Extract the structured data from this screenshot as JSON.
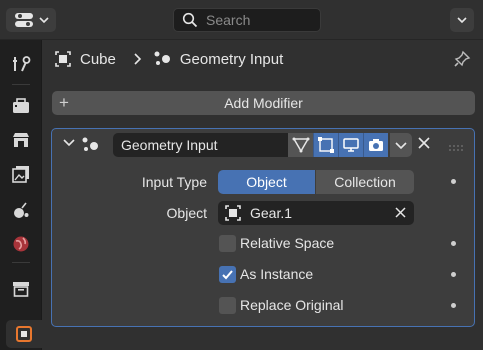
{
  "header": {
    "search_placeholder": "Search"
  },
  "tabs": [
    {
      "name": "tool",
      "icon": "tool-icon"
    },
    {
      "name": "render",
      "icon": "render-icon"
    },
    {
      "name": "output",
      "icon": "output-icon"
    },
    {
      "name": "view-layer",
      "icon": "view-layer-icon"
    },
    {
      "name": "scene",
      "icon": "scene-icon"
    },
    {
      "name": "world",
      "icon": "world-icon"
    },
    {
      "name": "collection",
      "icon": "collection-icon"
    },
    {
      "name": "object",
      "icon": "object-icon",
      "active": true
    }
  ],
  "breadcrumb": {
    "object": "Cube",
    "modifier": "Geometry Input"
  },
  "add_modifier_label": "Add Modifier",
  "modifier": {
    "name": "Geometry Input",
    "input_type_label": "Input Type",
    "input_type_options": [
      "Object",
      "Collection"
    ],
    "input_type_selected": "Object",
    "object_label": "Object",
    "object_value": "Gear.1",
    "relative_space_label": "Relative Space",
    "relative_space": false,
    "as_instance_label": "As Instance",
    "as_instance": true,
    "replace_original_label": "Replace Original",
    "replace_original": false
  },
  "colors": {
    "accent": "#4772b3",
    "panel_bg": "#3d3d3d",
    "tab_object_icon": "#e8772e",
    "world_icon": "#d9534f"
  }
}
